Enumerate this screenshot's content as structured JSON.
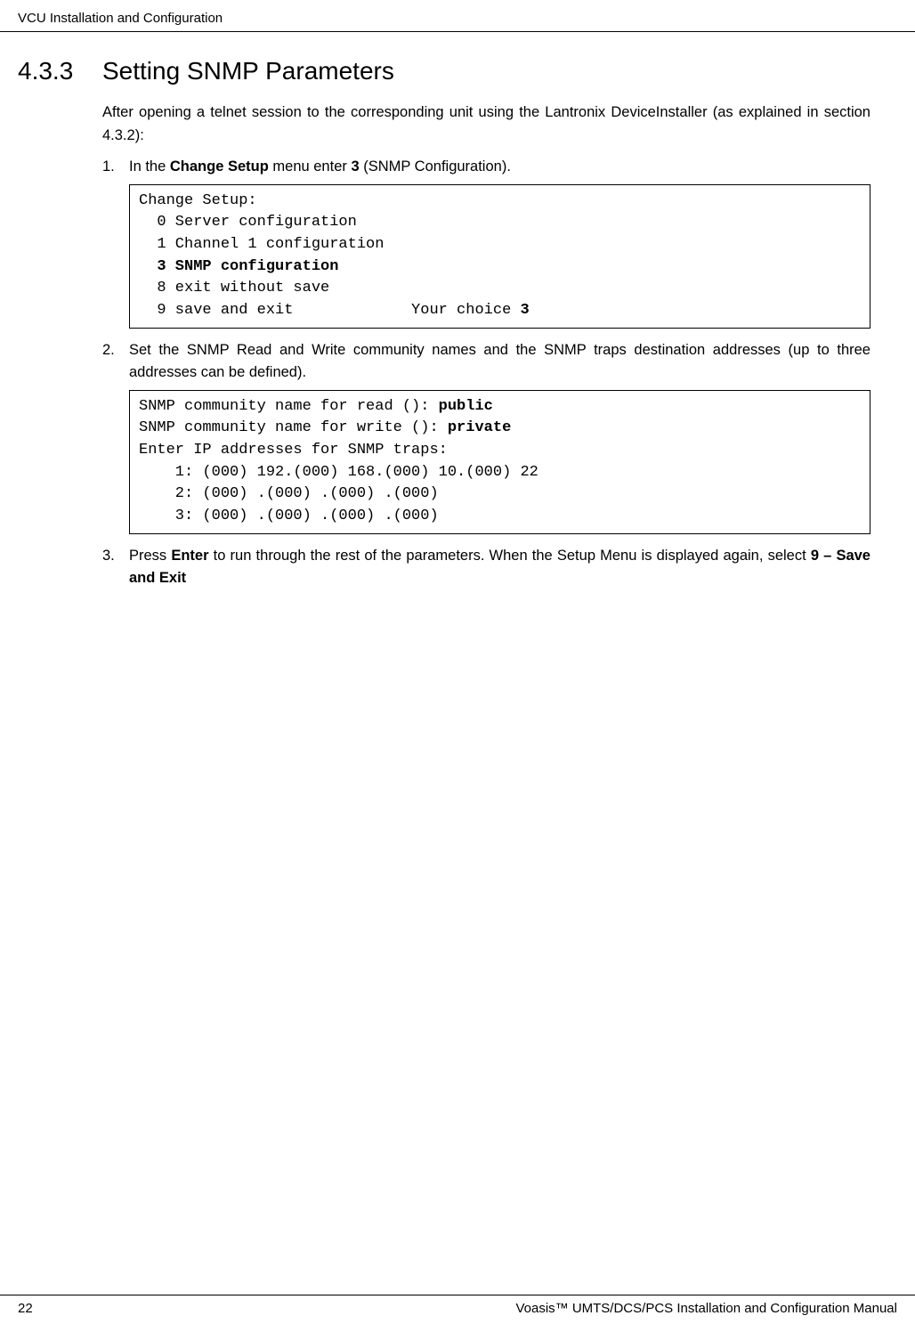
{
  "header": {
    "title": "VCU Installation and Configuration"
  },
  "section": {
    "number": "4.3.3",
    "title": "Setting SNMP Parameters"
  },
  "intro": {
    "text_a": "After opening a telnet session to the corresponding unit using the Lantronix DeviceInstaller (as explained in section 4.3.2):"
  },
  "step1": {
    "num": "1.",
    "prefix": "In the ",
    "bold1": "Change Setup",
    "mid": " menu enter ",
    "bold2": "3",
    "suffix": " (SNMP Configuration)."
  },
  "code1": {
    "l1": "Change Setup:",
    "l2": "  0 Server configuration",
    "l3": "  1 Channel 1 configuration",
    "l4_bold": "  3 SNMP configuration",
    "l5": "  8 exit without save",
    "l6a": "  9 save and exit             Your choice ",
    "l6b_bold": "3"
  },
  "step2": {
    "num": "2.",
    "text": "Set the SNMP Read and Write community names and the SNMP traps destination addresses (up to three addresses can be defined)."
  },
  "code2": {
    "l1a": "SNMP community name for read (): ",
    "l1b_bold": "public",
    "l2a": "SNMP community name for write (): ",
    "l2b_bold": "private",
    "l3": "Enter IP addresses for SNMP traps:",
    "l4": "    1: (000) 192.(000) 168.(000) 10.(000) 22",
    "l5": "    2: (000) .(000) .(000) .(000)",
    "l6": "    3: (000) .(000) .(000) .(000)"
  },
  "step3": {
    "num": "3.",
    "prefix": "Press ",
    "bold1": "Enter",
    "mid": " to run through the rest of the parameters. When the Setup Menu is displayed again, select ",
    "bold2": "9 – Save and Exit"
  },
  "footer": {
    "page": "22",
    "title": "Voasis™ UMTS/DCS/PCS Installation and Configuration Manual"
  }
}
